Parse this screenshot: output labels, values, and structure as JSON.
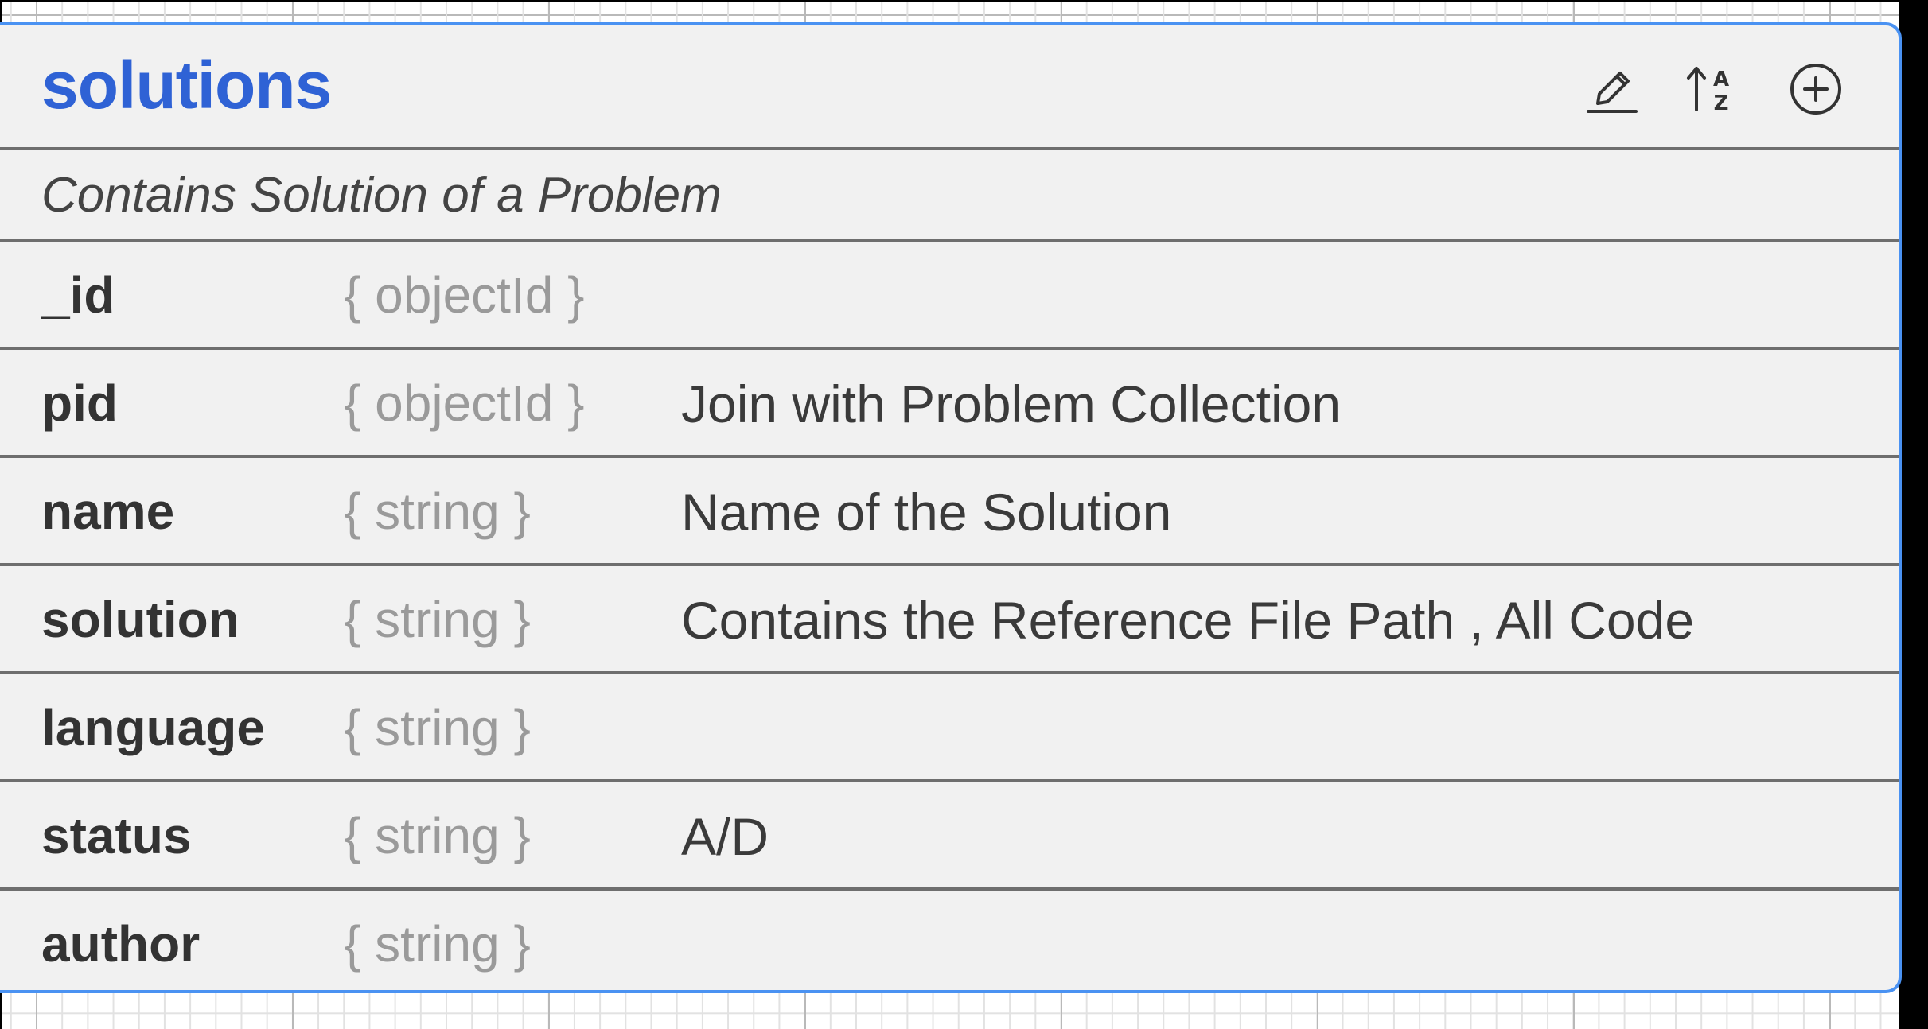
{
  "collection": {
    "name": "solutions",
    "description": "Contains Solution of a Problem",
    "actions": {
      "edit_icon": "edit-pencil-icon",
      "sort_icon": "sort-az-icon",
      "add_icon": "add-circle-icon"
    },
    "fields": [
      {
        "name": "_id",
        "type": "{ objectId }",
        "desc": ""
      },
      {
        "name": "pid",
        "type": "{ objectId }",
        "desc": "Join with Problem Collection"
      },
      {
        "name": "name",
        "type": "{ string }",
        "desc": "Name of the Solution"
      },
      {
        "name": "solution",
        "type": "{ string }",
        "desc": "Contains the Reference File Path , All Code"
      },
      {
        "name": "language",
        "type": "{ string }",
        "desc": ""
      },
      {
        "name": "status",
        "type": "{ string }",
        "desc": "A/D"
      },
      {
        "name": "author",
        "type": "{ string }",
        "desc": ""
      }
    ]
  },
  "colors": {
    "accent": "#4a92f2",
    "title": "#2f62d5",
    "card_bg": "#f1f1f1",
    "divider": "#6e6e6e"
  }
}
